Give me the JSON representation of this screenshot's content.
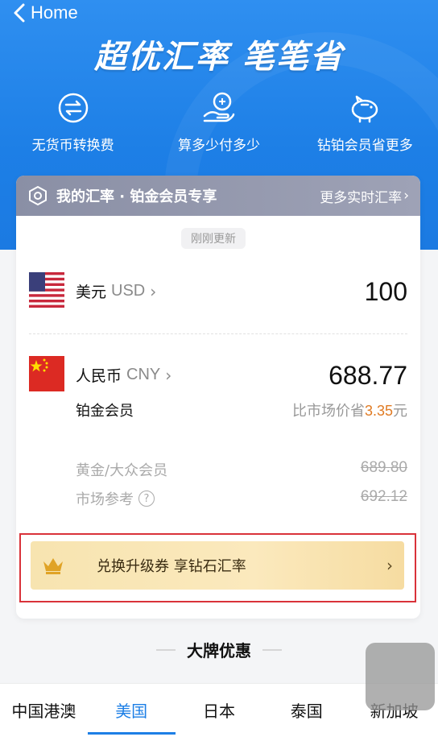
{
  "nav": {
    "back_label": "Home"
  },
  "headline": "超优汇率 笔笔省",
  "features": [
    {
      "icon": "exchange-icon",
      "label": "无货币转换费"
    },
    {
      "icon": "hand-coin-icon",
      "label": "算多少付多少"
    },
    {
      "icon": "piggy-bank-icon",
      "label": "钻铂会员省更多"
    }
  ],
  "card": {
    "header_title": "我的汇率 · 铂金会员专享",
    "more_label": "更多实时汇率",
    "updated": "刚刚更新",
    "from": {
      "name": "美元",
      "code": "USD",
      "amount": "100"
    },
    "to": {
      "name": "人民币",
      "code": "CNY",
      "amount": "688.77"
    },
    "tier": "铂金会员",
    "save_prefix": "比市场价省",
    "save_amount": "3.35",
    "save_suffix": "元",
    "refs": [
      {
        "label": "黄金/大众会员",
        "value": "689.80"
      },
      {
        "label": "市场参考",
        "value": "692.12"
      }
    ],
    "upgrade_text": "兑换升级券 享钻石汇率"
  },
  "section_title": "大牌优惠",
  "tabs": [
    {
      "label": "中国港澳",
      "active": false
    },
    {
      "label": "美国",
      "active": true
    },
    {
      "label": "日本",
      "active": false
    },
    {
      "label": "泰国",
      "active": false
    },
    {
      "label": "新加坡",
      "active": false
    }
  ],
  "colors": {
    "primary": "#1d7fe6",
    "accent": "#e07b24",
    "highlight_border": "#d9323a"
  }
}
